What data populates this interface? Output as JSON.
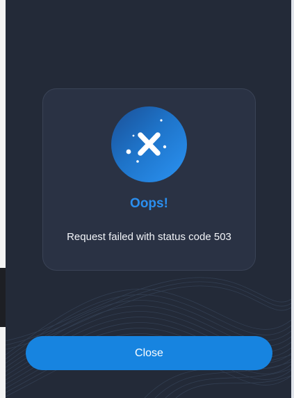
{
  "dialog": {
    "icon": "error-x-icon",
    "title": "Oops!",
    "message": "Request failed with status code 503",
    "close_label": "Close"
  },
  "colors": {
    "modal_background": "#232a38",
    "card_background": "#2a3244",
    "accent": "#1784e0",
    "title": "#2a8ff0",
    "text": "#f2f4f8"
  }
}
